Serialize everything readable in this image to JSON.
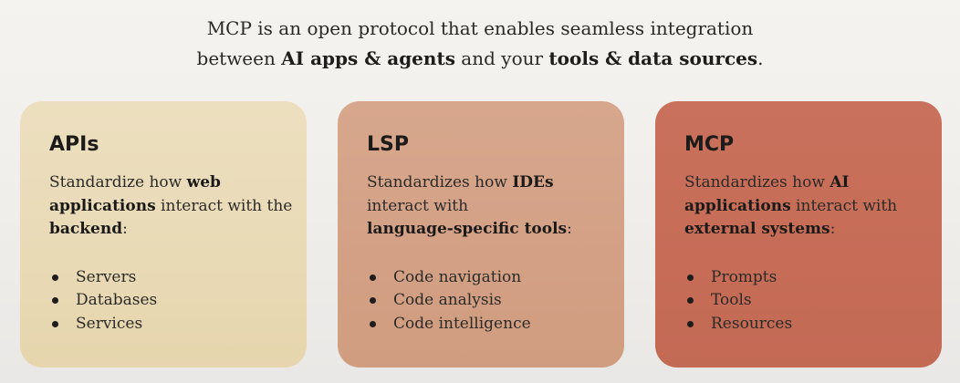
{
  "intro": {
    "line1": "MCP is an open protocol that enables seamless integration",
    "line2_pre": "between ",
    "line2_bold1": "AI apps & agents",
    "line2_mid": " and your ",
    "line2_bold2": "tools & data sources",
    "line2_end": "."
  },
  "cards": [
    {
      "title": "APIs",
      "desc": {
        "p1": "Standardize how ",
        "b1": "web applications",
        "p2": " interact with the ",
        "b2": "backend",
        "p3": ":"
      },
      "items": [
        "Servers",
        "Databases",
        "Services"
      ]
    },
    {
      "title": "LSP",
      "desc": {
        "p1": "Standardizes how ",
        "b1": "IDEs",
        "p2": " interact with ",
        "b2": "language-specific tools",
        "p3": ":"
      },
      "items": [
        "Code navigation",
        "Code analysis",
        "Code intelligence"
      ]
    },
    {
      "title": "MCP",
      "desc": {
        "p1": "Standardizes how ",
        "b1": "AI applications",
        "p2": " interact with ",
        "b2": "external systems",
        "p3": ":"
      },
      "items": [
        "Prompts",
        "Tools",
        "Resources"
      ]
    }
  ],
  "colors": {
    "apis_card": "#e9dab6",
    "lsp_card": "#d3a085",
    "mcp_card": "#c66c57",
    "text": "#1f1e1c"
  }
}
